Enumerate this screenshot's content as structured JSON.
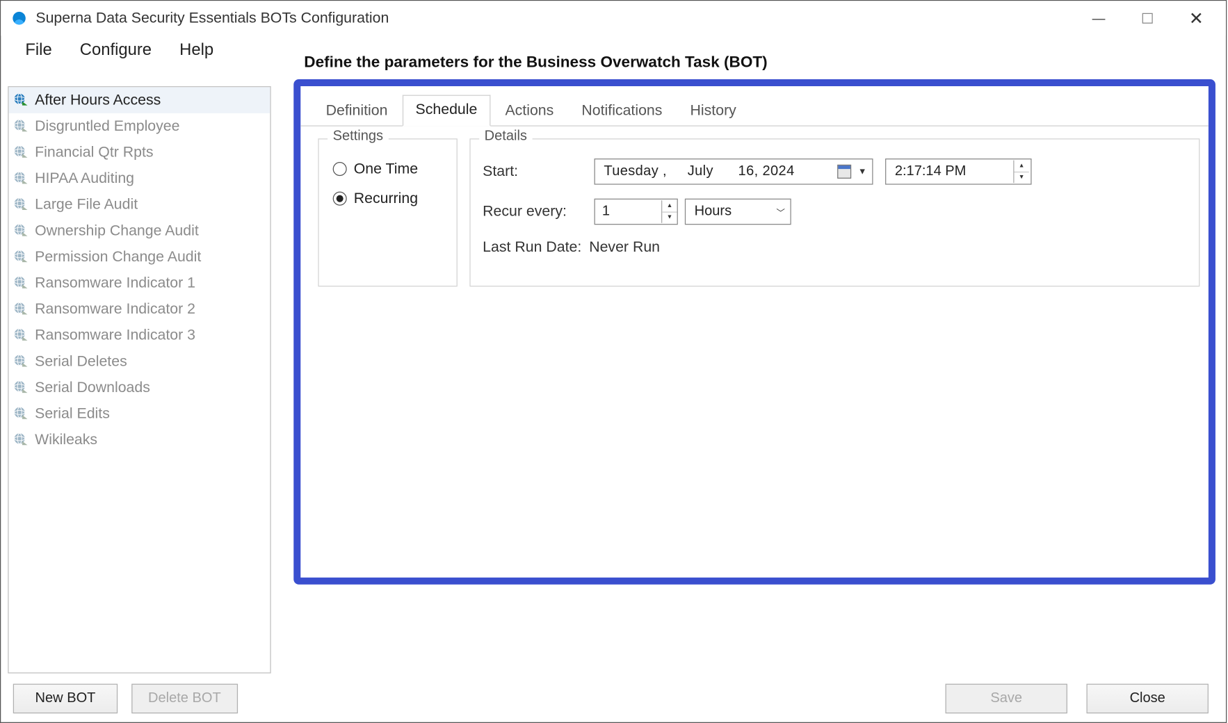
{
  "window": {
    "title": "Superna Data Security Essentials BOTs Configuration"
  },
  "menu": {
    "file": "File",
    "configure": "Configure",
    "help": "Help"
  },
  "heading": "Define the parameters for the Business Overwatch Task (BOT)",
  "bots": [
    {
      "label": "After Hours Access",
      "selected": true,
      "enabled": true
    },
    {
      "label": "Disgruntled Employee",
      "selected": false,
      "enabled": false
    },
    {
      "label": "Financial Qtr Rpts",
      "selected": false,
      "enabled": false
    },
    {
      "label": "HIPAA Auditing",
      "selected": false,
      "enabled": false
    },
    {
      "label": "Large File Audit",
      "selected": false,
      "enabled": false
    },
    {
      "label": "Ownership Change Audit",
      "selected": false,
      "enabled": false
    },
    {
      "label": "Permission Change Audit",
      "selected": false,
      "enabled": false
    },
    {
      "label": "Ransomware Indicator 1",
      "selected": false,
      "enabled": false
    },
    {
      "label": "Ransomware Indicator 2",
      "selected": false,
      "enabled": false
    },
    {
      "label": "Ransomware Indicator 3",
      "selected": false,
      "enabled": false
    },
    {
      "label": "Serial Deletes",
      "selected": false,
      "enabled": false
    },
    {
      "label": "Serial Downloads",
      "selected": false,
      "enabled": false
    },
    {
      "label": "Serial Edits",
      "selected": false,
      "enabled": false
    },
    {
      "label": "Wikileaks",
      "selected": false,
      "enabled": false
    }
  ],
  "buttons": {
    "new_bot": "New BOT",
    "delete_bot": "Delete BOT",
    "save": "Save",
    "close": "Close"
  },
  "tabs": {
    "definition": "Definition",
    "schedule": "Schedule",
    "actions": "Actions",
    "notifications": "Notifications",
    "history": "History",
    "active": "schedule"
  },
  "schedule": {
    "settings_legend": "Settings",
    "details_legend": "Details",
    "one_time": "One Time",
    "recurring": "Recurring",
    "mode": "recurring",
    "start_label": "Start:",
    "start_date": "Tuesday ,     July      16, 2024",
    "start_time": "2:17:14 PM",
    "recur_label": "Recur every:",
    "recur_value": "1",
    "recur_unit": "Hours",
    "lastrun_label": "Last Run Date:",
    "lastrun_value": "Never Run"
  }
}
